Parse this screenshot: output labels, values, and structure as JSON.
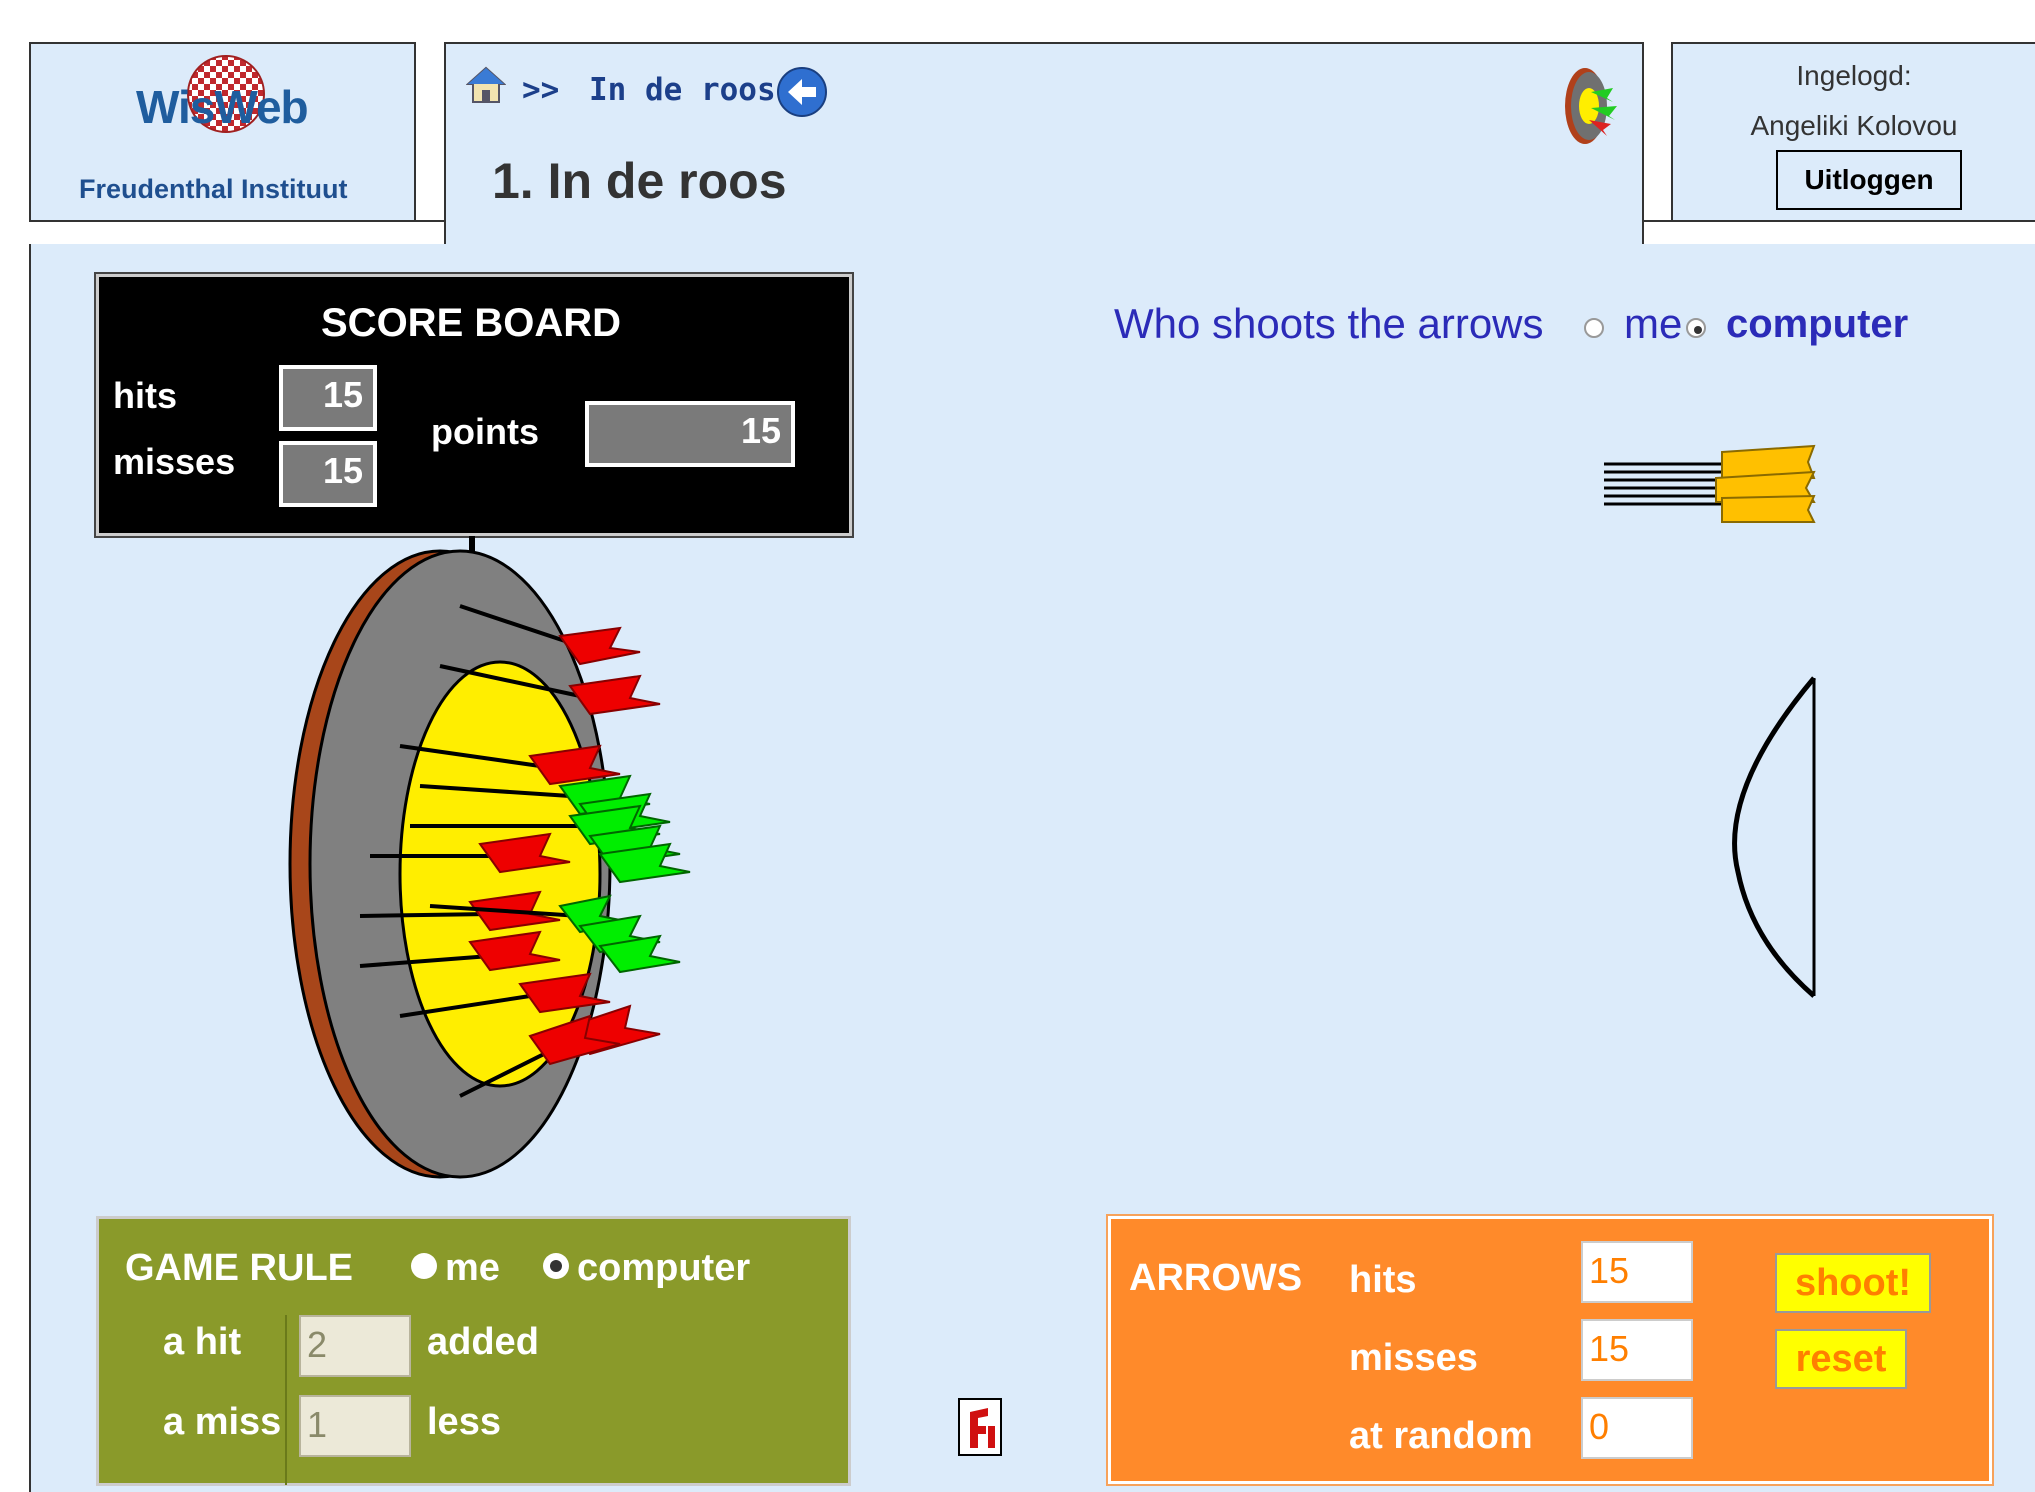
{
  "logo": {
    "word": "WisWeb",
    "subtitle": "Freudenthal Instituut"
  },
  "nav": {
    "separator": ">>",
    "breadcrumb": "In de roos",
    "page_title": "1.  In de roos"
  },
  "user": {
    "label": "Ingelogd:",
    "name": "Angeliki Kolovou",
    "logout": "Uitloggen"
  },
  "scoreboard": {
    "title": "SCORE BOARD",
    "hits_label": "hits",
    "hits": "15",
    "misses_label": "misses",
    "misses": "15",
    "points_label": "points",
    "points": "15"
  },
  "question": {
    "text": "Who shoots the arrows",
    "option_me": "me",
    "option_computer": "computer",
    "selected": "computer"
  },
  "game_rule": {
    "title": "GAME RULE",
    "option_me": "me",
    "option_computer": "computer",
    "selected": "computer",
    "hit_label": "a hit",
    "hit_value": "2",
    "hit_suffix": "added",
    "miss_label": "a miss",
    "miss_value": "1",
    "miss_suffix": "less"
  },
  "arrows": {
    "title": "ARROWS",
    "hits_label": "hits",
    "hits": "15",
    "misses_label": "misses",
    "misses": "15",
    "random_label": "at random",
    "random": "0",
    "shoot": "shoot!",
    "reset": "reset"
  },
  "colors": {
    "background": "#dcebfa",
    "rule_panel": "#8a9a2a",
    "arrows_panel": "#ff8a2a",
    "hit_arrow": "#00ee00",
    "miss_arrow": "#ee0000"
  }
}
